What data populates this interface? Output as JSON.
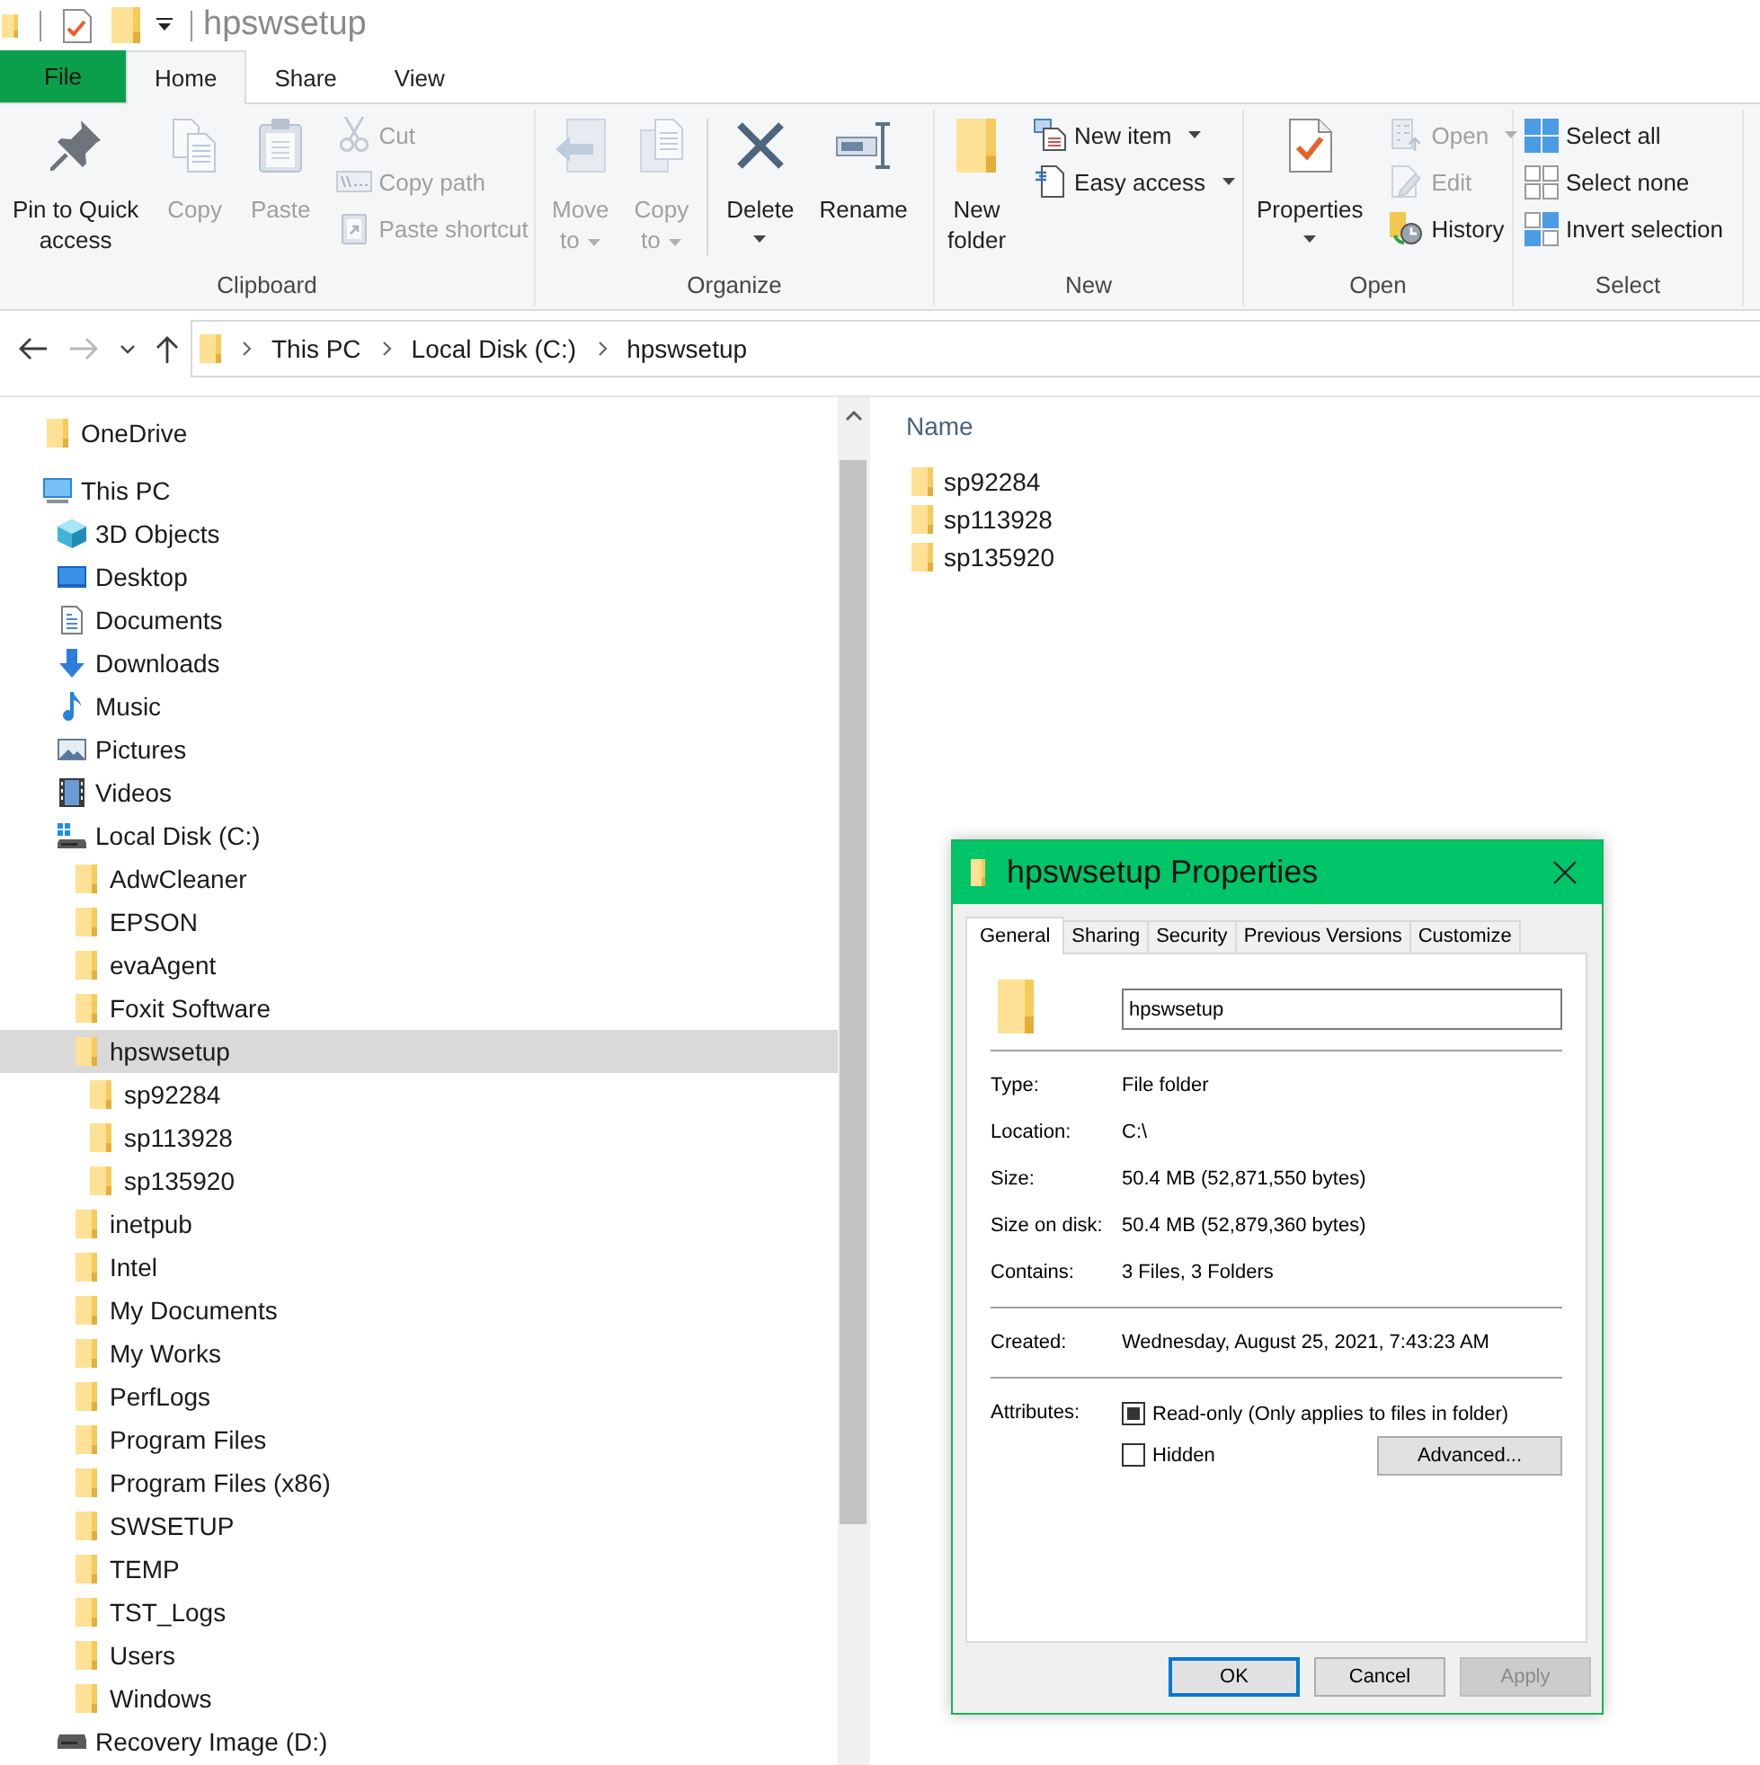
{
  "window": {
    "title": "hpswsetup"
  },
  "ribbon": {
    "tabs": [
      {
        "label": "File",
        "kind": "menu",
        "selected": false
      },
      {
        "label": "Home",
        "kind": "tab",
        "selected": true
      },
      {
        "label": "Share",
        "kind": "tab",
        "selected": false
      },
      {
        "label": "View",
        "kind": "tab",
        "selected": false
      }
    ],
    "groups": [
      {
        "label": "Clipboard",
        "sections": [
          {
            "buttons": [
              {
                "label": "Pin to Quick access",
                "kind": "large",
                "disabled": false,
                "dropdown": false
              },
              {
                "label": "Copy",
                "kind": "large",
                "disabled": true,
                "dropdown": false
              },
              {
                "label": "Paste",
                "kind": "large",
                "disabled": true,
                "dropdown": false
              },
              {
                "label": "Cut",
                "kind": "small",
                "disabled": true,
                "dropdown": false
              },
              {
                "label": "Copy path",
                "kind": "small",
                "disabled": true,
                "dropdown": false
              },
              {
                "label": "Paste shortcut",
                "kind": "small",
                "disabled": true,
                "dropdown": false
              }
            ]
          }
        ]
      },
      {
        "label": "Organize",
        "sections": [
          {
            "buttons": [
              {
                "label": "Move to",
                "kind": "large",
                "disabled": true,
                "dropdown": true
              },
              {
                "label": "Copy to",
                "kind": "large",
                "disabled": true,
                "dropdown": true
              }
            ]
          },
          {
            "buttons": [
              {
                "label": "Delete",
                "kind": "split",
                "disabled": false,
                "dropdown": true
              },
              {
                "label": "Rename",
                "kind": "large",
                "disabled": false,
                "dropdown": false
              }
            ]
          }
        ]
      },
      {
        "label": "New",
        "sections": [
          {
            "buttons": [
              {
                "label": "New folder",
                "kind": "large",
                "disabled": false,
                "dropdown": false
              },
              {
                "label": "New item",
                "kind": "small",
                "disabled": false,
                "dropdown": true
              },
              {
                "label": "Easy access",
                "kind": "small",
                "disabled": false,
                "dropdown": true
              }
            ]
          }
        ]
      },
      {
        "label": "Open",
        "sections": [
          {
            "buttons": [
              {
                "label": "Properties",
                "kind": "split",
                "disabled": false,
                "dropdown": true
              },
              {
                "label": "Open",
                "kind": "small",
                "disabled": true,
                "dropdown": true
              },
              {
                "label": "Edit",
                "kind": "small",
                "disabled": true,
                "dropdown": false
              },
              {
                "label": "History",
                "kind": "small",
                "disabled": false,
                "dropdown": false
              }
            ]
          }
        ]
      },
      {
        "label": "Select",
        "sections": [
          {
            "buttons": [
              {
                "label": "Select all",
                "kind": "small",
                "disabled": false,
                "dropdown": false
              },
              {
                "label": "Select none",
                "kind": "small",
                "disabled": false,
                "dropdown": false
              },
              {
                "label": "Invert selection",
                "kind": "small",
                "disabled": false,
                "dropdown": false
              }
            ]
          }
        ]
      }
    ]
  },
  "history_buttons": [
    {
      "kind": "back",
      "disabled": false
    },
    {
      "kind": "forward",
      "disabled": true
    },
    {
      "kind": "recent",
      "disabled": false
    },
    {
      "kind": "up",
      "disabled": false
    }
  ],
  "address_bar": {
    "path": [
      "This PC",
      "Local Disk (C:)",
      "hpswsetup"
    ]
  },
  "navigation": {
    "items": [
      {
        "label": "OneDrive",
        "kind": "folder",
        "selected": false
      },
      {
        "label": "This PC",
        "kind": "computer",
        "selected": false,
        "children": [
          {
            "label": "3D Objects",
            "kind": "objects",
            "selected": false
          },
          {
            "label": "Desktop",
            "kind": "desktop",
            "selected": false
          },
          {
            "label": "Documents",
            "kind": "documents",
            "selected": false
          },
          {
            "label": "Downloads",
            "kind": "downloads",
            "selected": false
          },
          {
            "label": "Music",
            "kind": "music",
            "selected": false
          },
          {
            "label": "Pictures",
            "kind": "pictures",
            "selected": false
          },
          {
            "label": "Videos",
            "kind": "videos",
            "selected": false
          },
          {
            "label": "Local Disk (C:)",
            "kind": "system_drive",
            "selected": false,
            "children": [
              {
                "label": "AdwCleaner",
                "kind": "folder",
                "selected": false
              },
              {
                "label": "EPSON",
                "kind": "folder",
                "selected": false
              },
              {
                "label": "evaAgent",
                "kind": "folder",
                "selected": false
              },
              {
                "label": "Foxit Software",
                "kind": "folder",
                "selected": false
              },
              {
                "label": "hpswsetup",
                "kind": "folder",
                "selected": true,
                "children": [
                  {
                    "label": "sp92284",
                    "kind": "folder",
                    "selected": false
                  },
                  {
                    "label": "sp113928",
                    "kind": "folder",
                    "selected": false
                  },
                  {
                    "label": "sp135920",
                    "kind": "folder",
                    "selected": false
                  }
                ]
              },
              {
                "label": "inetpub",
                "kind": "folder",
                "selected": false
              },
              {
                "label": "Intel",
                "kind": "folder",
                "selected": false
              },
              {
                "label": "My Documents",
                "kind": "folder",
                "selected": false
              },
              {
                "label": "My Works",
                "kind": "folder",
                "selected": false
              },
              {
                "label": "PerfLogs",
                "kind": "folder",
                "selected": false
              },
              {
                "label": "Program Files",
                "kind": "folder",
                "selected": false
              },
              {
                "label": "Program Files (x86)",
                "kind": "folder",
                "selected": false
              },
              {
                "label": "SWSETUP",
                "kind": "folder",
                "selected": false
              },
              {
                "label": "TEMP",
                "kind": "folder",
                "selected": false
              },
              {
                "label": "TST_Logs",
                "kind": "folder",
                "selected": false
              },
              {
                "label": "Users",
                "kind": "folder",
                "selected": false
              },
              {
                "label": "Windows",
                "kind": "folder",
                "selected": false
              }
            ]
          },
          {
            "label": "Recovery Image (D:)",
            "kind": "drive",
            "selected": false
          }
        ]
      }
    ]
  },
  "file_list": {
    "columns": [
      "Name"
    ],
    "rows": [
      {
        "name": "sp92284",
        "selected": false
      },
      {
        "name": "sp113928",
        "selected": false
      },
      {
        "name": "sp135920",
        "selected": false
      }
    ]
  },
  "properties_dialog": {
    "title": "hpswsetup Properties",
    "tabs": [
      {
        "label": "General",
        "selected": true
      },
      {
        "label": "Sharing",
        "selected": false
      },
      {
        "label": "Security",
        "selected": false
      },
      {
        "label": "Previous Versions",
        "selected": false
      },
      {
        "label": "Customize",
        "selected": false
      }
    ],
    "name_field": {
      "value": "hpswsetup"
    },
    "property_groups": [
      {
        "rows": [
          {
            "label": "Type:",
            "value": "File folder"
          },
          {
            "label": "Location:",
            "value": "C:\\"
          },
          {
            "label": "Size:",
            "value": "50.4 MB (52,871,550 bytes)"
          },
          {
            "label": "Size on disk:",
            "value": "50.4 MB (52,879,360 bytes)"
          },
          {
            "label": "Contains:",
            "value": "3 Files, 3 Folders"
          }
        ]
      },
      {
        "rows": [
          {
            "label": "Created:",
            "value": "Wednesday, August 25, 2021, 7:43:23 AM"
          }
        ]
      }
    ],
    "attributes": {
      "label": "Attributes:",
      "options": [
        {
          "label": "Read-only (Only applies to files in folder)",
          "checked": false,
          "mixed": true
        },
        {
          "label": "Hidden",
          "checked": false,
          "mixed": false
        }
      ],
      "button": "Advanced..."
    },
    "buttons": [
      {
        "label": "OK",
        "default": true,
        "disabled": false
      },
      {
        "label": "Cancel",
        "default": false,
        "disabled": false
      },
      {
        "label": "Apply",
        "default": false,
        "disabled": true
      }
    ]
  }
}
